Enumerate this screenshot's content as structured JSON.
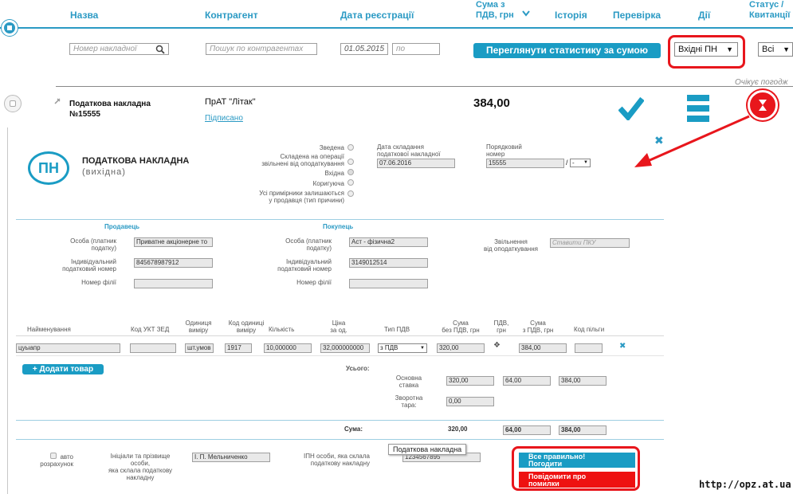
{
  "header": {
    "col_name": "Назва",
    "col_contractor": "Контрагент",
    "col_date": "Дата реєстрації",
    "col_sum_line1": "Сума з",
    "col_sum_line2": "ПДВ, грн",
    "col_history": "Історія",
    "col_check": "Перевірка",
    "col_actions": "Дії",
    "col_status_line1": "Статус /",
    "col_status_line2": "Квитанції"
  },
  "filters": {
    "invoice_number_placeholder": "Номер накладної",
    "contractor_placeholder": "Пошук по контрагентах",
    "date_from": "01.05.2015",
    "date_to_placeholder": "по",
    "stats_button": "Переглянути статистику за сумою",
    "type_select": "Вхідні ПН",
    "status_select": "Всі",
    "awaiting_text": "Очікує погодж"
  },
  "row": {
    "title_line1": "Податкова накладна",
    "title_line2": "№15555",
    "contractor": "ПрАТ \"Літак\"",
    "signed_link": "Підписано",
    "sum": "384,00"
  },
  "doc": {
    "logo_text": "ПН",
    "title": "ПОДАТКОВА НАКЛАДНА",
    "subtitle": "(вихідна)",
    "flags": {
      "issued": "Зведена",
      "exempt_line1": "Складена на операції",
      "exempt_line2": "звільнені від оподаткування",
      "outgoing": "Вхідна",
      "corrective": "Коригуюча",
      "copies_line1": "Усі примірники залишаються",
      "copies_line2": "у продавця (тип причини)"
    },
    "date_label_line1": "Дата складання",
    "date_label_line2": "податкової накладної",
    "date_value": "07.06.2016",
    "number_label_line1": "Порядковий",
    "number_label_line2": "номер",
    "number_value": "15555",
    "number_suffix": "-",
    "seller_heading": "Продавець",
    "buyer_heading": "Покупець",
    "person_label_line1": "Особа (платник",
    "person_label_line2": "податку)",
    "ipn_label_line1": "Індивідуальний",
    "ipn_label_line2": "податковий номер",
    "branch_label": "Номер філії",
    "seller_name": "Приватне акціонерне то",
    "seller_ipn": "845678987912",
    "buyer_name": "Аст - фізична2",
    "buyer_ipn": "3149012514",
    "exempt_label_line1": "Звільнення",
    "exempt_label_line2": "від оподаткування",
    "exempt_placeholder": "Ставити ПКУ"
  },
  "table": {
    "headers": {
      "name": "Найменування",
      "code": "Код УКТ ЗЕД",
      "unit_line1": "Одиниця",
      "unit_line2": "виміру",
      "unit_code_line1": "Код одиниці",
      "unit_code_line2": "виміру",
      "qty": "Кількість",
      "price_line1": "Ціна",
      "price_line2": "за од.",
      "vat_type": "Тип ПДВ",
      "sum_novat_line1": "Сума",
      "sum_novat_line2": "без ПДВ, грн",
      "vat_line1": "ПДВ,",
      "vat_line2": "грн",
      "sum_vat_line1": "Сума",
      "sum_vat_line2": "з ПДВ, грн",
      "benefit_code": "Код пільги"
    },
    "row": {
      "name": "цуыапр",
      "code": "",
      "unit": "шт.умов",
      "unit_code": "1917",
      "qty": "10,000000",
      "price": "32,000000000",
      "vat_type": "з ПДВ",
      "sum_novat": "320,00",
      "vat": "",
      "sum_vat": "384,00",
      "benefit_code": ""
    },
    "add_button": "+ Додати товар",
    "totals_label": "Усього:",
    "main_rate_line1": "Основна",
    "main_rate_line2": "ставка",
    "main_rate_values": [
      "320,00",
      "64,00",
      "384,00"
    ],
    "return_line1": "Зворотна",
    "return_line2": "тара:",
    "return_value": "0,00",
    "sum_label": "Сума:",
    "sum_values": [
      "320,00",
      "64,00",
      "384,00"
    ]
  },
  "footer": {
    "auto_line1": "авто",
    "auto_line2": "розрахунок",
    "initials_line1": "Ініціали та прізвище",
    "initials_line2": "особи,",
    "initials_line3": "яка склала податкову",
    "initials_line4": "накладну",
    "initials_value": "І. П. Мельниченко",
    "ipn_line1": "ІПН особи, яка склала",
    "ipn_line2": "податкову накладну",
    "ipn_value": "1234567895",
    "tooltip": "Податкова накладна",
    "approve_line1": "Все правильно!",
    "approve_line2": "Погодити",
    "report_line1": "Повідомити про",
    "report_line2": "помилки",
    "watermark": "http://opz.at.ua"
  },
  "colors": {
    "accent": "#2b9ac4",
    "button": "#1a9cc4",
    "highlight": "#e8161c",
    "error_button": "#ee1111"
  }
}
